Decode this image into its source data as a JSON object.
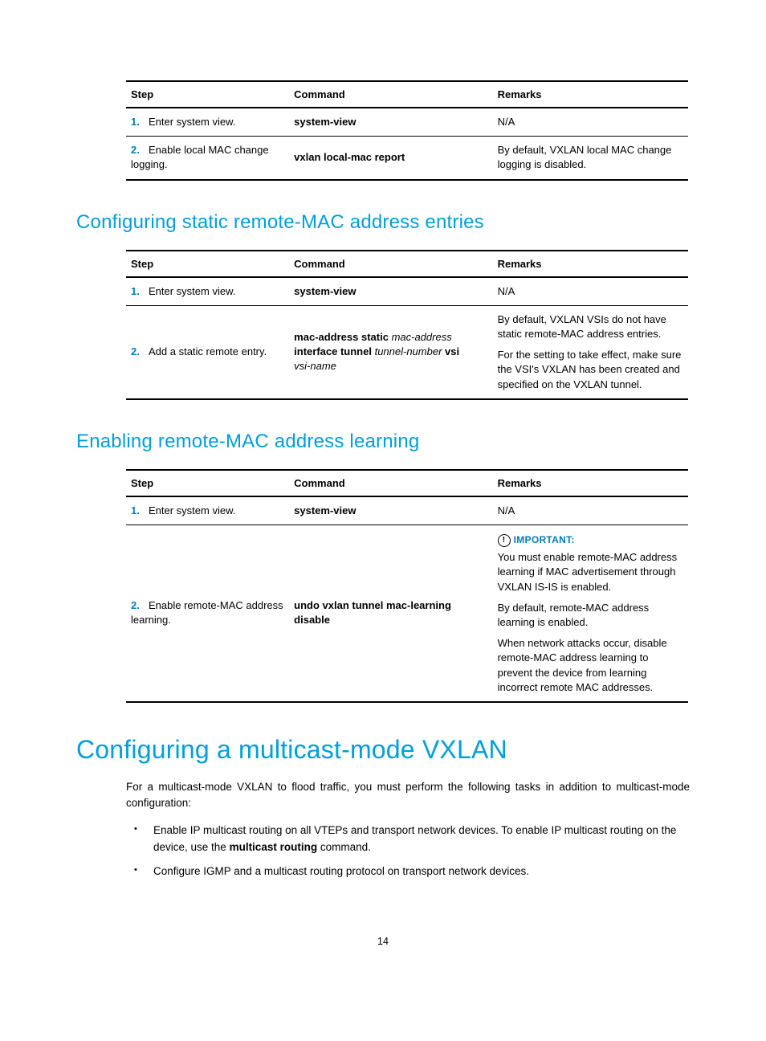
{
  "table1": {
    "headers": [
      "Step",
      "Command",
      "Remarks"
    ],
    "rows": [
      {
        "num": "1.",
        "step": "Enter system view.",
        "cmd_bold1": "system-view",
        "remarks": "N/A"
      },
      {
        "num": "2.",
        "step": "Enable local MAC change logging.",
        "cmd_bold1": "vxlan local-mac report",
        "remarks": "By default, VXLAN local MAC change logging is disabled."
      }
    ]
  },
  "heading2a": "Configuring static remote-MAC address entries",
  "table2": {
    "headers": [
      "Step",
      "Command",
      "Remarks"
    ],
    "rows": [
      {
        "num": "1.",
        "step": "Enter system view.",
        "cmd_bold1": "system-view",
        "remarks_p1": "N/A"
      },
      {
        "num": "2.",
        "step": "Add a static remote entry.",
        "cmd_bold1": "mac-address static",
        "cmd_ital1": "mac-address",
        "cmd_bold2": "interface tunnel",
        "cmd_ital2": "tunnel-number",
        "cmd_bold3": "vsi",
        "cmd_ital3": "vsi-name",
        "remarks_p1": "By default, VXLAN VSIs do not have static remote-MAC address entries.",
        "remarks_p2": "For the setting to take effect, make sure the VSI's VXLAN has been created and specified on the VXLAN tunnel."
      }
    ]
  },
  "heading2b": "Enabling remote-MAC address learning",
  "table3": {
    "headers": [
      "Step",
      "Command",
      "Remarks"
    ],
    "row1": {
      "num": "1.",
      "step": "Enter system view.",
      "cmd_bold1": "system-view",
      "remarks": "N/A"
    },
    "row2": {
      "num": "2.",
      "step": "Enable remote-MAC address learning.",
      "cmd_bold1": "undo vxlan tunnel mac-learning disable",
      "important_label": "IMPORTANT:",
      "remarks_p1": "You must enable remote-MAC address learning if MAC advertisement through VXLAN IS-IS is enabled.",
      "remarks_p2": "By default, remote-MAC address learning is enabled.",
      "remarks_p3": "When network attacks occur, disable remote-MAC address learning to prevent the device from learning incorrect remote MAC addresses."
    }
  },
  "heading1": "Configuring a multicast-mode VXLAN",
  "intro_para": "For a multicast-mode VXLAN to flood traffic, you must perform the following tasks in addition to multicast-mode configuration:",
  "bullet1_pre": "Enable IP multicast routing on all VTEPs and transport network devices. To enable IP multicast routing on the device, use the ",
  "bullet1_bold": "multicast routing",
  "bullet1_post": " command.",
  "bullet2": "Configure IGMP and a multicast routing protocol on transport network devices.",
  "page_number": "14"
}
